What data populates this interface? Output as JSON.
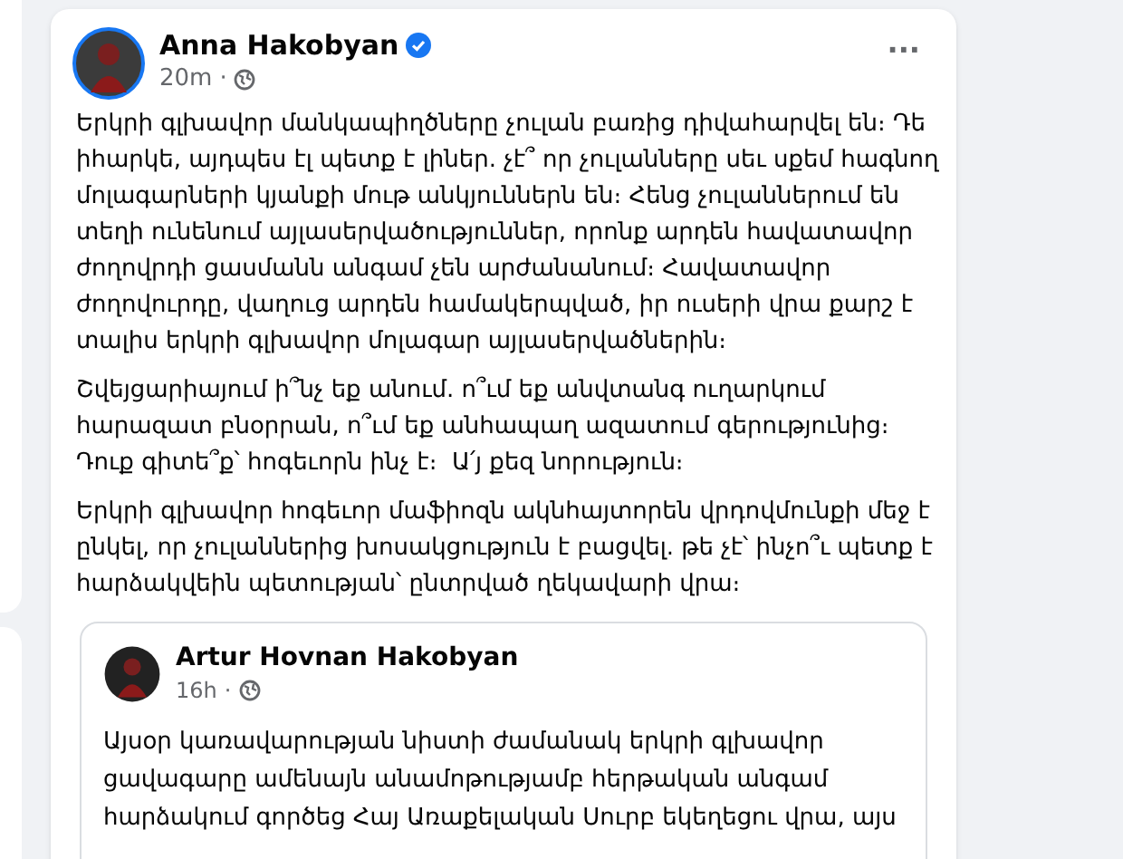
{
  "post": {
    "author": "Anna Hakobyan",
    "verified": true,
    "time": "20m",
    "separator": "·",
    "more": "···",
    "paragraphs": [
      {
        "lines": [
          "Երկրի գլխավոր մանկապիղծները չուլան բառից դիվահարվել են։ Դե",
          "իհարկե, այդպես էլ պետք է լիներ. չէ՞ որ չուլանները սեւ սքեմ հագնող",
          "մոլագարների կյանքի մութ անկյուններն են։ Հենց չուլաններում են",
          "տեղի ունենում այլասերվածություններ, որոնք արդեն հավատավոր",
          "ժողովրդի ցասմանն անգամ չեն արժանանում։ Հավատավոր",
          "ժողովուրդը, վաղուց արդեն համակերպված, իր ուսերի վրա քարշ է",
          "տալիս երկրի գլխավոր մոլագար այլասերվածներին։"
        ]
      },
      {
        "lines": [
          "Շվեյցարիայում ի՞նչ եք անում. ո՞ւմ եք անվտանգ ուղարկում",
          "հարազատ բնօրրան, ո՞ւմ եք անհապաղ ազատում գերությունից։",
          "Դուք գիտե՞ք՝ հոգեւորն ինչ է։  Ա՛յ քեզ նորություն։"
        ]
      },
      {
        "lines": [
          "Երկրի գլխավոր հոգեւոր մաֆիոզն ակնհայտորեն վրդովմունքի մեջ է",
          "ընկել, որ չուլաններից խոսակցություն է բացվել. թե չէ՝ ինչո՞ւ պետք է",
          "հարձակվեին պետության՝ ընտրված ղեկավարի վրա։"
        ]
      }
    ],
    "shared": {
      "author": "Artur Hovnan Hakobyan",
      "time": "16h",
      "separator": "·",
      "lines": [
        "Այսօր կառավարության նիստի ժամանակ երկրի գլխավոր",
        "ցավագարը ամենայն անամոթությամբ հերթական անգամ",
        "հարձակում գործեց Հայ Առաքելական Սուրբ եկեղեցու վրա, այս"
      ]
    }
  }
}
